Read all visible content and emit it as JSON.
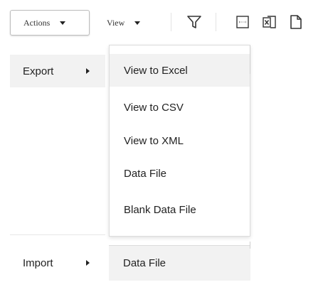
{
  "toolbar": {
    "actions_label": "Actions",
    "view_label": "View",
    "icons": [
      "filter-icon",
      "xml-icon",
      "excel-icon",
      "document-icon"
    ]
  },
  "menu": {
    "items": [
      {
        "label": "Export",
        "submenu": [
          "View to Excel",
          "View to CSV",
          "View to XML",
          "Data File",
          "Blank Data File"
        ]
      },
      {
        "label": "Import",
        "submenu": [
          "Data File"
        ]
      }
    ]
  },
  "colors": {
    "highlight": "#f2f2f2",
    "border": "#dcdcdc",
    "text": "#222222"
  }
}
